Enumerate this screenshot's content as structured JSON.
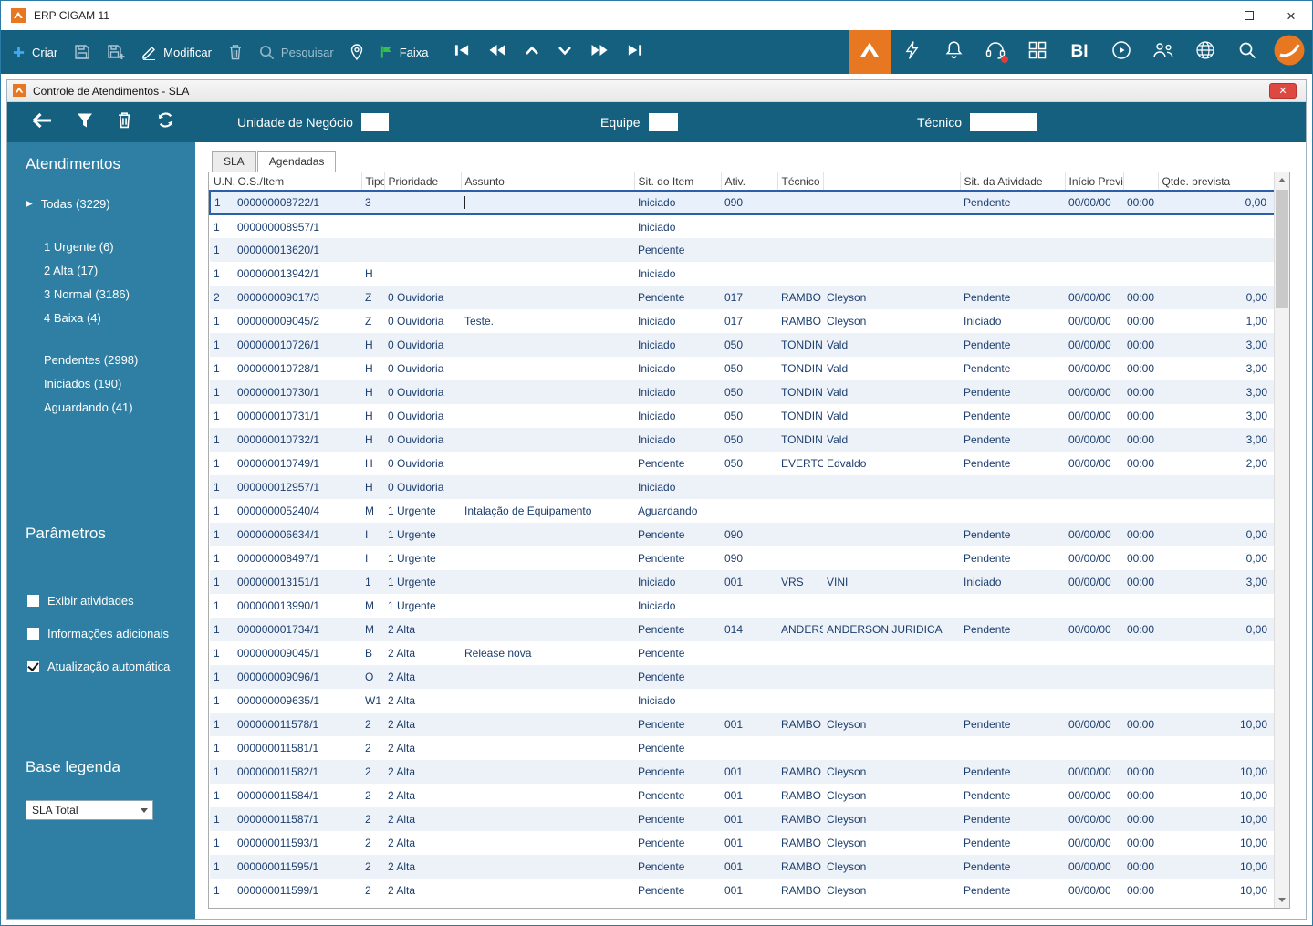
{
  "window": {
    "title": "ERP CIGAM 11"
  },
  "toolbar": {
    "criar_label": "Criar",
    "modificar_label": "Modificar",
    "pesquisar_label": "Pesquisar",
    "faixa_label": "Faixa",
    "bi_label": "BI"
  },
  "child_window": {
    "title": "Controle de Atendimentos - SLA"
  },
  "filter_bar": {
    "unidade_label": "Unidade de Negócio",
    "unidade_value": "",
    "equipe_label": "Equipe",
    "equipe_value": "",
    "tecnico_label": "Técnico",
    "tecnico_value": ""
  },
  "sidebar": {
    "atendimentos_title": "Atendimentos",
    "todas_label": "Todas (3229)",
    "priority_items": [
      "1 Urgente (6)",
      "2 Alta (17)",
      "3 Normal (3186)",
      "4 Baixa (4)"
    ],
    "status_items": [
      "Pendentes (2998)",
      "Iniciados (190)",
      "Aguardando (41)"
    ],
    "parametros_title": "Parâmetros",
    "checkboxes": [
      {
        "label": "Exibir atividades",
        "checked": false
      },
      {
        "label": "Informações adicionais",
        "checked": false
      },
      {
        "label": "Atualização automática",
        "checked": true
      }
    ],
    "base_legenda_title": "Base legenda",
    "base_legenda_value": "SLA Total"
  },
  "tabs": [
    {
      "label": "SLA",
      "active": false
    },
    {
      "label": "Agendadas",
      "active": true
    }
  ],
  "table": {
    "headers": [
      "U.N.",
      "O.S./Item",
      "Tipo",
      "Prioridade",
      "Assunto",
      "Sit. do Item",
      "Ativ.",
      "Técnico",
      "",
      "Sit. da Atividade",
      "Início Previsto",
      "",
      "Qtde. prevista"
    ],
    "rows": [
      {
        "un": "1",
        "os": "000000008722/1",
        "tipo": "3",
        "prioridade": "",
        "assunto": "",
        "sit_item": "Iniciado",
        "ativ": "090",
        "tecnico": "",
        "tecnico_nome": "",
        "sit_atividade": "Pendente",
        "inicio": "00/00/00",
        "hora": "00:00",
        "qtde": "0,00",
        "selected": true
      },
      {
        "un": "1",
        "os": "000000008957/1",
        "tipo": "",
        "prioridade": "",
        "assunto": "",
        "sit_item": "Iniciado",
        "ativ": "",
        "tecnico": "",
        "tecnico_nome": "",
        "sit_atividade": "",
        "inicio": "",
        "hora": "",
        "qtde": ""
      },
      {
        "un": "1",
        "os": "000000013620/1",
        "tipo": "",
        "prioridade": "",
        "assunto": "",
        "sit_item": "Pendente",
        "ativ": "",
        "tecnico": "",
        "tecnico_nome": "",
        "sit_atividade": "",
        "inicio": "",
        "hora": "",
        "qtde": ""
      },
      {
        "un": "1",
        "os": "000000013942/1",
        "tipo": "H",
        "prioridade": "",
        "assunto": "",
        "sit_item": "Iniciado",
        "ativ": "",
        "tecnico": "",
        "tecnico_nome": "",
        "sit_atividade": "",
        "inicio": "",
        "hora": "",
        "qtde": ""
      },
      {
        "un": "2",
        "os": "000000009017/3",
        "tipo": "Z",
        "prioridade": "0 Ouvidoria",
        "assunto": "",
        "sit_item": "Pendente",
        "ativ": "017",
        "tecnico": "RAMBO",
        "tecnico_nome": "Cleyson",
        "sit_atividade": "Pendente",
        "inicio": "00/00/00",
        "hora": "00:00",
        "qtde": "0,00"
      },
      {
        "un": "1",
        "os": "000000009045/2",
        "tipo": "Z",
        "prioridade": "0 Ouvidoria",
        "assunto": "Teste.",
        "sit_item": "Iniciado",
        "ativ": "017",
        "tecnico": "RAMBO",
        "tecnico_nome": "Cleyson",
        "sit_atividade": "Iniciado",
        "inicio": "00/00/00",
        "hora": "00:00",
        "qtde": "1,00"
      },
      {
        "un": "1",
        "os": "000000010726/1",
        "tipo": "H",
        "prioridade": "0 Ouvidoria",
        "assunto": "",
        "sit_item": "Iniciado",
        "ativ": "050",
        "tecnico": "TONDIN",
        "tecnico_nome": "Vald",
        "sit_atividade": "Pendente",
        "inicio": "00/00/00",
        "hora": "00:00",
        "qtde": "3,00"
      },
      {
        "un": "1",
        "os": "000000010728/1",
        "tipo": "H",
        "prioridade": "0 Ouvidoria",
        "assunto": "",
        "sit_item": "Iniciado",
        "ativ": "050",
        "tecnico": "TONDIN",
        "tecnico_nome": "Vald",
        "sit_atividade": "Pendente",
        "inicio": "00/00/00",
        "hora": "00:00",
        "qtde": "3,00"
      },
      {
        "un": "1",
        "os": "000000010730/1",
        "tipo": "H",
        "prioridade": "0 Ouvidoria",
        "assunto": "",
        "sit_item": "Iniciado",
        "ativ": "050",
        "tecnico": "TONDIN",
        "tecnico_nome": "Vald",
        "sit_atividade": "Pendente",
        "inicio": "00/00/00",
        "hora": "00:00",
        "qtde": "3,00"
      },
      {
        "un": "1",
        "os": "000000010731/1",
        "tipo": "H",
        "prioridade": "0 Ouvidoria",
        "assunto": "",
        "sit_item": "Iniciado",
        "ativ": "050",
        "tecnico": "TONDIN",
        "tecnico_nome": "Vald",
        "sit_atividade": "Pendente",
        "inicio": "00/00/00",
        "hora": "00:00",
        "qtde": "3,00"
      },
      {
        "un": "1",
        "os": "000000010732/1",
        "tipo": "H",
        "prioridade": "0 Ouvidoria",
        "assunto": "",
        "sit_item": "Iniciado",
        "ativ": "050",
        "tecnico": "TONDIN",
        "tecnico_nome": "Vald",
        "sit_atividade": "Pendente",
        "inicio": "00/00/00",
        "hora": "00:00",
        "qtde": "3,00"
      },
      {
        "un": "1",
        "os": "000000010749/1",
        "tipo": "H",
        "prioridade": "0 Ouvidoria",
        "assunto": "",
        "sit_item": "Pendente",
        "ativ": "050",
        "tecnico": "EVERTO",
        "tecnico_nome": "Edvaldo",
        "sit_atividade": "Pendente",
        "inicio": "00/00/00",
        "hora": "00:00",
        "qtde": "2,00"
      },
      {
        "un": "1",
        "os": "000000012957/1",
        "tipo": "H",
        "prioridade": "0 Ouvidoria",
        "assunto": "",
        "sit_item": "Iniciado",
        "ativ": "",
        "tecnico": "",
        "tecnico_nome": "",
        "sit_atividade": "",
        "inicio": "",
        "hora": "",
        "qtde": ""
      },
      {
        "un": "1",
        "os": "000000005240/4",
        "tipo": "M",
        "prioridade": "1 Urgente",
        "assunto": "Intalação de Equipamento",
        "sit_item": "Aguardando",
        "ativ": "",
        "tecnico": "",
        "tecnico_nome": "",
        "sit_atividade": "",
        "inicio": "",
        "hora": "",
        "qtde": ""
      },
      {
        "un": "1",
        "os": "000000006634/1",
        "tipo": "I",
        "prioridade": "1 Urgente",
        "assunto": "",
        "sit_item": "Pendente",
        "ativ": "090",
        "tecnico": "",
        "tecnico_nome": "",
        "sit_atividade": "Pendente",
        "inicio": "00/00/00",
        "hora": "00:00",
        "qtde": "0,00"
      },
      {
        "un": "1",
        "os": "000000008497/1",
        "tipo": "I",
        "prioridade": "1 Urgente",
        "assunto": "",
        "sit_item": "Pendente",
        "ativ": "090",
        "tecnico": "",
        "tecnico_nome": "",
        "sit_atividade": "Pendente",
        "inicio": "00/00/00",
        "hora": "00:00",
        "qtde": "0,00"
      },
      {
        "un": "1",
        "os": "000000013151/1",
        "tipo": "1",
        "prioridade": "1 Urgente",
        "assunto": "",
        "sit_item": "Iniciado",
        "ativ": "001",
        "tecnico": "VRS",
        "tecnico_nome": "VINI",
        "sit_atividade": "Iniciado",
        "inicio": "00/00/00",
        "hora": "00:00",
        "qtde": "3,00"
      },
      {
        "un": "1",
        "os": "000000013990/1",
        "tipo": "M",
        "prioridade": "1 Urgente",
        "assunto": "",
        "sit_item": "Iniciado",
        "ativ": "",
        "tecnico": "",
        "tecnico_nome": "",
        "sit_atividade": "",
        "inicio": "",
        "hora": "",
        "qtde": ""
      },
      {
        "un": "1",
        "os": "000000001734/1",
        "tipo": "M",
        "prioridade": "2 Alta",
        "assunto": "",
        "sit_item": "Pendente",
        "ativ": "014",
        "tecnico": "ANDERS",
        "tecnico_nome": "ANDERSON JURIDICA",
        "sit_atividade": "Pendente",
        "inicio": "00/00/00",
        "hora": "00:00",
        "qtde": "0,00"
      },
      {
        "un": "1",
        "os": "000000009045/1",
        "tipo": "B",
        "prioridade": "2 Alta",
        "assunto": "Release nova",
        "sit_item": "Pendente",
        "ativ": "",
        "tecnico": "",
        "tecnico_nome": "",
        "sit_atividade": "",
        "inicio": "",
        "hora": "",
        "qtde": ""
      },
      {
        "un": "1",
        "os": "000000009096/1",
        "tipo": "O",
        "prioridade": "2 Alta",
        "assunto": "",
        "sit_item": "Pendente",
        "ativ": "",
        "tecnico": "",
        "tecnico_nome": "",
        "sit_atividade": "",
        "inicio": "",
        "hora": "",
        "qtde": ""
      },
      {
        "un": "1",
        "os": "000000009635/1",
        "tipo": "W1",
        "prioridade": "2 Alta",
        "assunto": "",
        "sit_item": "Iniciado",
        "ativ": "",
        "tecnico": "",
        "tecnico_nome": "",
        "sit_atividade": "",
        "inicio": "",
        "hora": "",
        "qtde": ""
      },
      {
        "un": "1",
        "os": "000000011578/1",
        "tipo": "2",
        "prioridade": "2 Alta",
        "assunto": "",
        "sit_item": "Pendente",
        "ativ": "001",
        "tecnico": "RAMBO",
        "tecnico_nome": "Cleyson",
        "sit_atividade": "Pendente",
        "inicio": "00/00/00",
        "hora": "00:00",
        "qtde": "10,00"
      },
      {
        "un": "1",
        "os": "000000011581/1",
        "tipo": "2",
        "prioridade": "2 Alta",
        "assunto": "",
        "sit_item": "Pendente",
        "ativ": "",
        "tecnico": "",
        "tecnico_nome": "",
        "sit_atividade": "",
        "inicio": "",
        "hora": "",
        "qtde": ""
      },
      {
        "un": "1",
        "os": "000000011582/1",
        "tipo": "2",
        "prioridade": "2 Alta",
        "assunto": "",
        "sit_item": "Pendente",
        "ativ": "001",
        "tecnico": "RAMBO",
        "tecnico_nome": "Cleyson",
        "sit_atividade": "Pendente",
        "inicio": "00/00/00",
        "hora": "00:00",
        "qtde": "10,00"
      },
      {
        "un": "1",
        "os": "000000011584/1",
        "tipo": "2",
        "prioridade": "2 Alta",
        "assunto": "",
        "sit_item": "Pendente",
        "ativ": "001",
        "tecnico": "RAMBO",
        "tecnico_nome": "Cleyson",
        "sit_atividade": "Pendente",
        "inicio": "00/00/00",
        "hora": "00:00",
        "qtde": "10,00"
      },
      {
        "un": "1",
        "os": "000000011587/1",
        "tipo": "2",
        "prioridade": "2 Alta",
        "assunto": "",
        "sit_item": "Pendente",
        "ativ": "001",
        "tecnico": "RAMBO",
        "tecnico_nome": "Cleyson",
        "sit_atividade": "Pendente",
        "inicio": "00/00/00",
        "hora": "00:00",
        "qtde": "10,00"
      },
      {
        "un": "1",
        "os": "000000011593/1",
        "tipo": "2",
        "prioridade": "2 Alta",
        "assunto": "",
        "sit_item": "Pendente",
        "ativ": "001",
        "tecnico": "RAMBO",
        "tecnico_nome": "Cleyson",
        "sit_atividade": "Pendente",
        "inicio": "00/00/00",
        "hora": "00:00",
        "qtde": "10,00"
      },
      {
        "un": "1",
        "os": "000000011595/1",
        "tipo": "2",
        "prioridade": "2 Alta",
        "assunto": "",
        "sit_item": "Pendente",
        "ativ": "001",
        "tecnico": "RAMBO",
        "tecnico_nome": "Cleyson",
        "sit_atividade": "Pendente",
        "inicio": "00/00/00",
        "hora": "00:00",
        "qtde": "10,00"
      },
      {
        "un": "1",
        "os": "000000011599/1",
        "tipo": "2",
        "prioridade": "2 Alta",
        "assunto": "",
        "sit_item": "Pendente",
        "ativ": "001",
        "tecnico": "RAMBO",
        "tecnico_nome": "Cleyson",
        "sit_atividade": "Pendente",
        "inicio": "00/00/00",
        "hora": "00:00",
        "qtde": "10,00"
      }
    ]
  },
  "colors": {
    "toolbar_teal": "#15607f",
    "sidebar_teal": "#2e7fa3",
    "accent_orange": "#e87722",
    "selected_border": "#2b5fa8",
    "row_text_navy": "#1c3e6e",
    "faixa_green": "#35c04a",
    "criar_blue": "#3fa9f5",
    "close_red": "#dd4840"
  }
}
